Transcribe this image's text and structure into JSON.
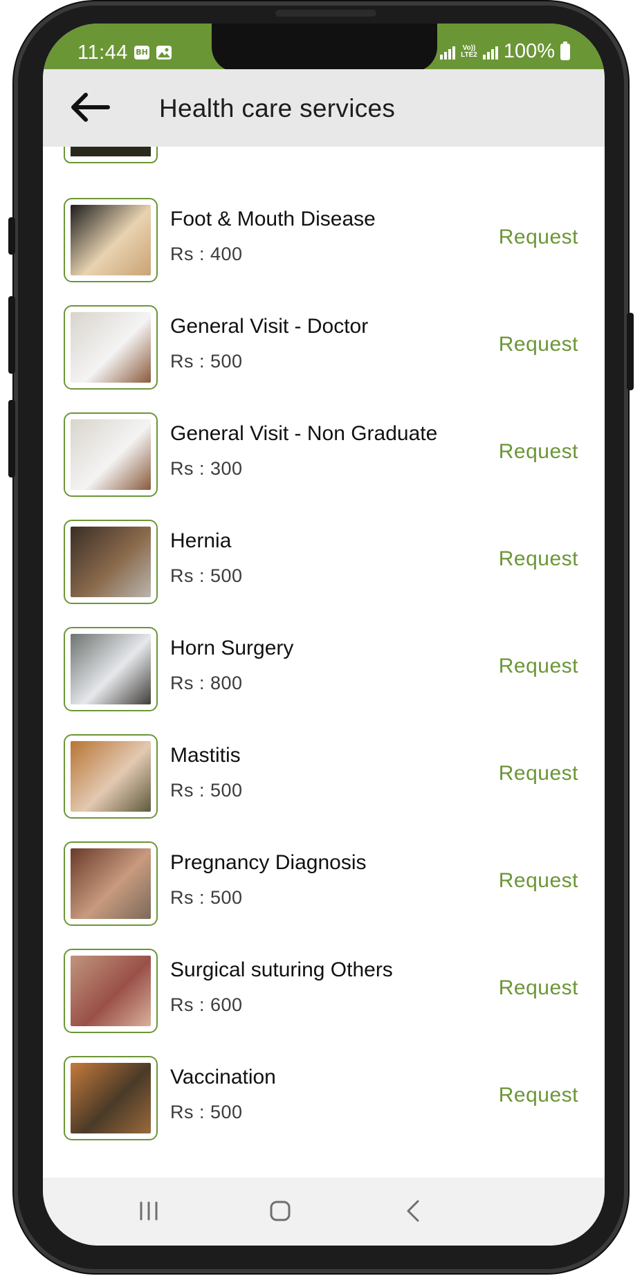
{
  "status_bar": {
    "time": "11:44",
    "bh_badge": "BH",
    "volte_label_1": "Vo))",
    "volte_label_2": "LTE2",
    "battery": "100%",
    "background_color": "#6b9636"
  },
  "app_bar": {
    "back_icon": "arrow-left-icon",
    "title": "Health care services"
  },
  "services": [
    {
      "name": "Foot & Mouth Disease",
      "price": "Rs : 400",
      "action": "Request",
      "thumb_colors": [
        "#1e1e1e",
        "#e8d3b0",
        "#c9a274"
      ]
    },
    {
      "name": "General Visit - Doctor",
      "price": "Rs : 500",
      "action": "Request",
      "thumb_colors": [
        "#d9d4cc",
        "#f4f4f4",
        "#8a5a3c"
      ]
    },
    {
      "name": "General Visit - Non Graduate",
      "price": "Rs : 300",
      "action": "Request",
      "thumb_colors": [
        "#d9d4cc",
        "#f4f4f4",
        "#8a5a3c"
      ]
    },
    {
      "name": "Hernia",
      "price": "Rs : 500",
      "action": "Request",
      "thumb_colors": [
        "#3a2e26",
        "#8a6a4c",
        "#b9b5ad"
      ]
    },
    {
      "name": "Horn Surgery",
      "price": "Rs : 800",
      "action": "Request",
      "thumb_colors": [
        "#6e7470",
        "#e6e8ec",
        "#3f3d38"
      ]
    },
    {
      "name": "Mastitis",
      "price": "Rs : 500",
      "action": "Request",
      "thumb_colors": [
        "#b87434",
        "#e3c9b2",
        "#5e5a3c"
      ]
    },
    {
      "name": "Pregnancy Diagnosis",
      "price": "Rs : 500",
      "action": "Request",
      "thumb_colors": [
        "#6a3a2a",
        "#c89a7e",
        "#7a6a5a"
      ]
    },
    {
      "name": "Surgical suturing Others",
      "price": "Rs : 600",
      "action": "Request",
      "thumb_colors": [
        "#c0957e",
        "#9a5048",
        "#d8b09c"
      ]
    },
    {
      "name": "Vaccination",
      "price": "Rs : 500",
      "action": "Request",
      "thumb_colors": [
        "#c57a3c",
        "#4a3a28",
        "#9a6a3c"
      ]
    }
  ],
  "colors": {
    "accent": "#6b9636",
    "title_text": "#1d1d1d",
    "price_text": "#3c3c3c"
  },
  "nav_bar": {
    "recents_icon": "recents-icon",
    "home_icon": "home-icon",
    "back_icon": "back-chevron-icon"
  }
}
